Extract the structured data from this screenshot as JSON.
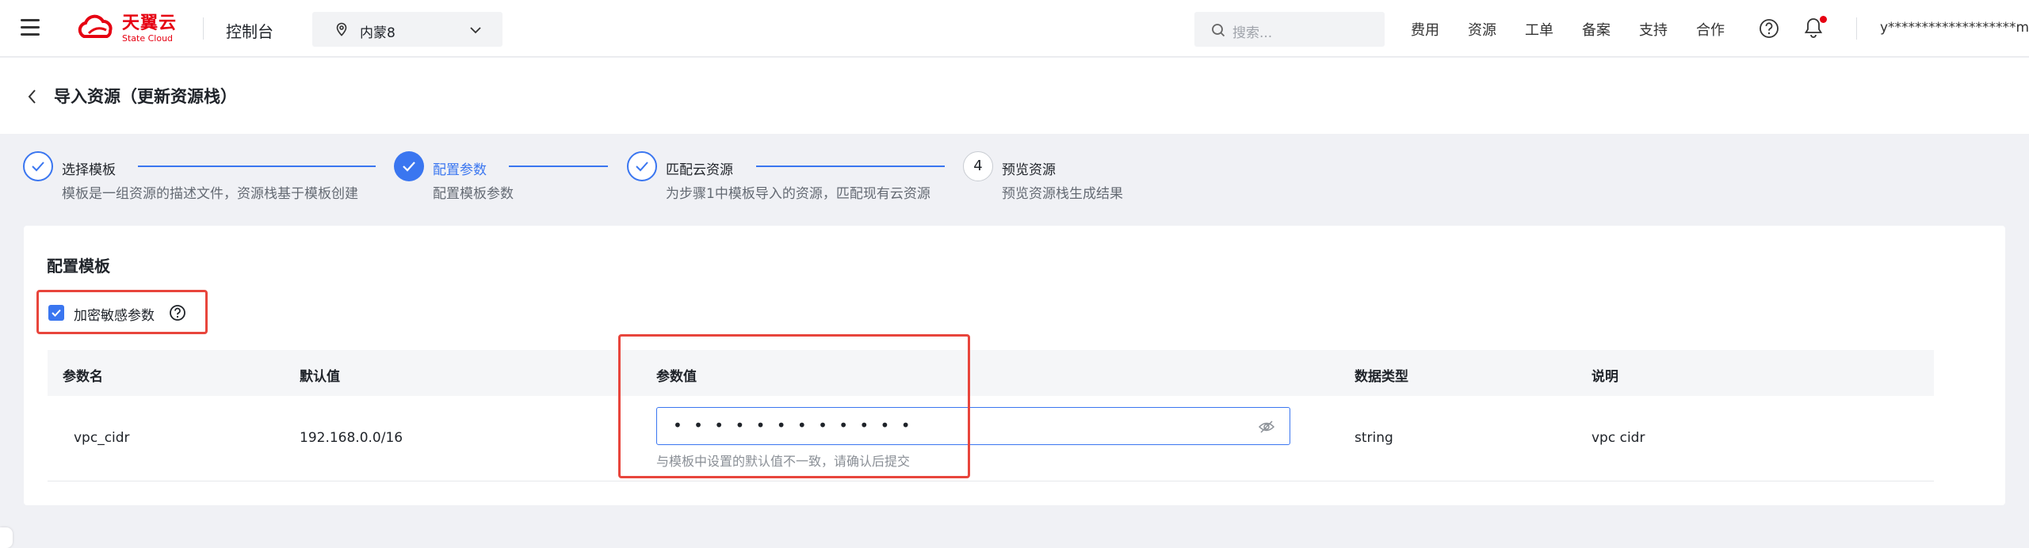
{
  "header": {
    "logo_cn": "天翼云",
    "logo_en": "State Cloud",
    "console": "控制台",
    "region": "内蒙8",
    "search_placeholder": "搜索...",
    "nav": [
      "费用",
      "资源",
      "工单",
      "备案",
      "支持",
      "合作"
    ],
    "user": "y*******************m"
  },
  "page": {
    "title": "导入资源（更新资源栈）"
  },
  "steps": [
    {
      "title": "选择模板",
      "desc": "模板是一组资源的描述文件，资源栈基于模板创建",
      "state": "done"
    },
    {
      "title": "配置参数",
      "desc": "配置模板参数",
      "state": "active"
    },
    {
      "title": "匹配云资源",
      "desc": "为步骤1中模板导入的资源，匹配现有云资源",
      "state": "done"
    },
    {
      "title": "预览资源",
      "desc": "预览资源栈生成结果",
      "state": "pending",
      "number": "4"
    }
  ],
  "config": {
    "section_title": "配置模板",
    "encrypt_label": "加密敏感参数",
    "encrypt_checked": true,
    "columns": [
      "参数名",
      "默认值",
      "参数值",
      "数据类型",
      "说明"
    ],
    "row": {
      "name": "vpc_cidr",
      "default": "192.168.0.0/16",
      "value_masked": "• • • • • • • • • • • •",
      "type": "string",
      "desc": "vpc cidr"
    },
    "hint": "与模板中设置的默认值不一致，请确认后提交"
  },
  "colors": {
    "accent": "#3a76f0",
    "brand": "#e60012",
    "highlight": "#e8453c"
  }
}
